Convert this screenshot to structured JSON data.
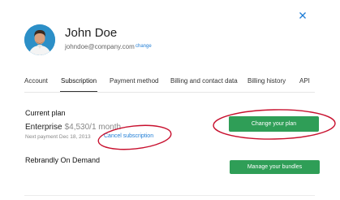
{
  "icons": {
    "close": "close-icon",
    "avatar": "user-avatar-photo"
  },
  "colors": {
    "accent_green": "#2f9e57",
    "link_blue": "#1f7dd6",
    "annotation_red": "#c8102e"
  },
  "user": {
    "name": "John Doe",
    "email": "johndoe@company.com",
    "change_label": "change"
  },
  "tabs": [
    {
      "label": "Account",
      "active": false
    },
    {
      "label": "Subscription",
      "active": true
    },
    {
      "label": "Payment method",
      "active": false
    },
    {
      "label": "Billing and contact data",
      "active": false
    },
    {
      "label": "Billing history",
      "active": false
    },
    {
      "label": "API",
      "active": false
    }
  ],
  "current_plan": {
    "title": "Current plan",
    "plan_name": "Enterprise",
    "price": "$4,530/1 month",
    "next_payment": "Next payment Dec 18, 2013",
    "cancel_label": "Cancel subscription",
    "change_button": "Change your plan"
  },
  "bundles": {
    "title": "Rebrandly On Demand",
    "manage_button": "Manage your bundles"
  }
}
